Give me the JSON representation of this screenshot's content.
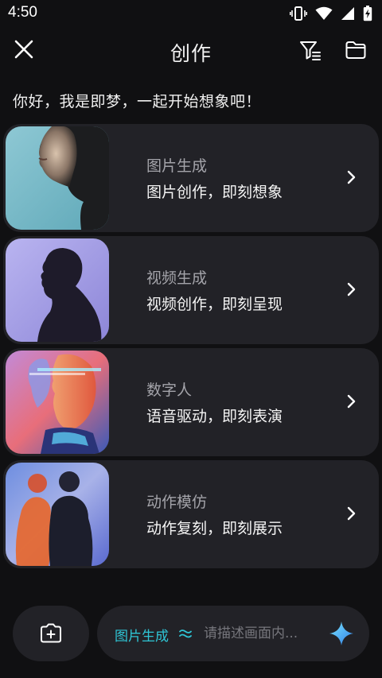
{
  "status_bar": {
    "time": "4:50",
    "icons": [
      "vibrate-icon",
      "wifi-icon",
      "signal-icon",
      "battery-charging-icon"
    ]
  },
  "header": {
    "title": "创作",
    "close_icon": "close-icon",
    "filter_icon": "filter-icon",
    "folder_icon": "folder-icon"
  },
  "greeting": "你好，我是即梦，一起开始想象吧！",
  "cards": [
    {
      "title": "图片生成",
      "subtitle": "图片创作，即刻想象",
      "thumb": "portrait-profile-photo"
    },
    {
      "title": "视频生成",
      "subtitle": "视频创作，即刻呈现",
      "thumb": "silhouette-photo"
    },
    {
      "title": "数字人",
      "subtitle": "语音驱动，即刻表演",
      "thumb": "double-exposure-face-photo"
    },
    {
      "title": "动作模仿",
      "subtitle": "动作复刻，即刻展示",
      "thumb": "motion-blur-figures-photo"
    }
  ],
  "bottom_bar": {
    "mode_label": "图片生成",
    "mode_toggle_icon": "swap-icon",
    "prompt_placeholder": "请描述画面内...",
    "camera_icon": "camera-plus-icon",
    "submit_icon": "sparkle-icon"
  },
  "colors": {
    "background": "#101012",
    "card": "#222227",
    "accent": "#2fc5d5"
  }
}
